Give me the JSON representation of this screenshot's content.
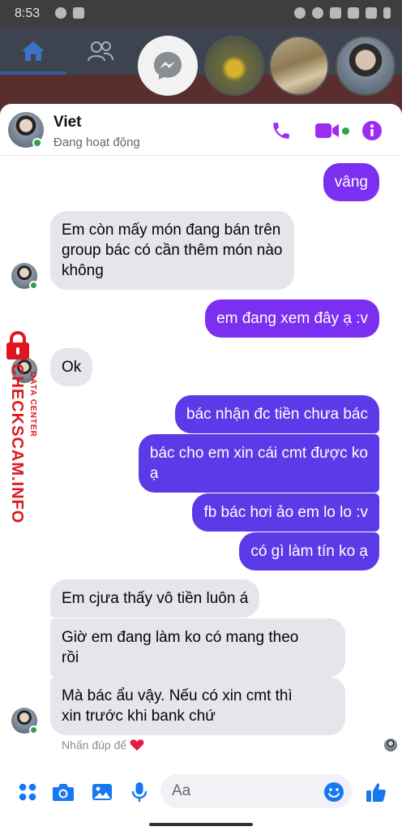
{
  "status_bar": {
    "time": "8:53"
  },
  "chat": {
    "contact_name": "Viet",
    "contact_status": "Đang hoạt động",
    "messages": [
      {
        "sender": "me",
        "text": "vâng"
      },
      {
        "sender": "them",
        "lines": [
          "Em còn mấy món đang bán trên",
          "group bác có cần thêm món nào",
          "không"
        ]
      },
      {
        "sender": "me",
        "text": "em đang xem đây ạ :v"
      },
      {
        "sender": "them",
        "text": "Ok"
      },
      {
        "sender": "me",
        "text": "bác nhận đc tiền chưa bác"
      },
      {
        "sender": "me",
        "lines": [
          "bác cho em xin cái cmt được ko",
          "ạ"
        ]
      },
      {
        "sender": "me",
        "text": "fb bác hơi ảo em lo lo :v"
      },
      {
        "sender": "me",
        "text": "có gì làm tín ko ạ"
      },
      {
        "sender": "them",
        "text": "Em cjưa thấy vô tiền luôn á"
      },
      {
        "sender": "them",
        "lines": [
          "Giờ em đang làm ko có mang theo",
          "rồi"
        ]
      },
      {
        "sender": "them",
        "lines": [
          "Mà bác ẩu vậy. Nếu có xin cmt thì",
          "xin trước khi bank chứ"
        ]
      }
    ],
    "double_tap_hint": "Nhấn đúp để",
    "heart_icon": "heart-icon"
  },
  "composer": {
    "placeholder": "Aa"
  },
  "watermark": {
    "title": "CHECKSCAM.INFO",
    "subtitle": "DATA CENTER"
  },
  "colors": {
    "accent": "#9b2cf0",
    "outgoing_bubble": "#7b2ff0",
    "incoming_bubble": "#e4e6eb",
    "online": "#31a24c",
    "composer_icons": "#1877f2",
    "watermark": "#e0161e"
  }
}
